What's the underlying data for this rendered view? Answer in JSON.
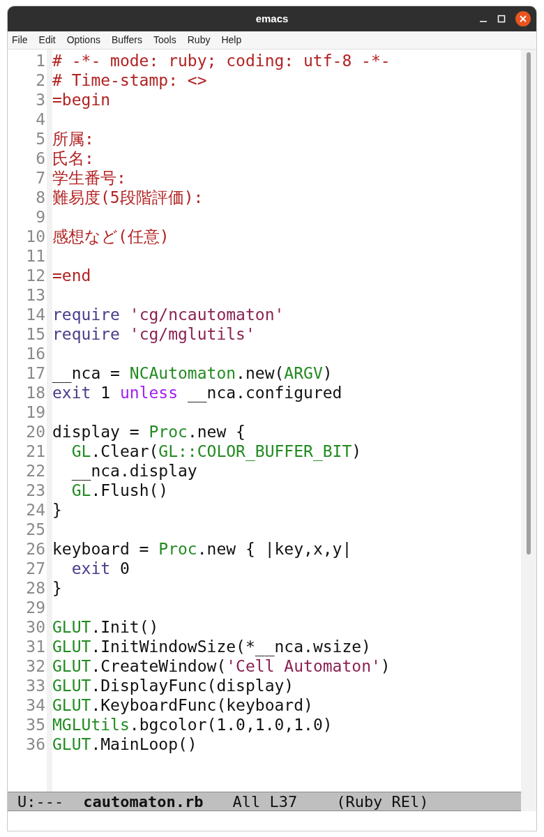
{
  "window": {
    "title": "emacs"
  },
  "menu": [
    "File",
    "Edit",
    "Options",
    "Buffers",
    "Tools",
    "Ruby",
    "Help"
  ],
  "lines": [
    {
      "number": "1",
      "tokens": [
        {
          "kind": "comment",
          "text": "# -*- mode: ruby; coding: utf-8 -*-"
        }
      ]
    },
    {
      "number": "2",
      "tokens": [
        {
          "kind": "comment",
          "text": "# Time-stamp: <>"
        }
      ]
    },
    {
      "number": "3",
      "tokens": [
        {
          "kind": "comment",
          "text": "=begin"
        }
      ]
    },
    {
      "number": "4"
    },
    {
      "number": "5",
      "tokens": [
        {
          "kind": "comment",
          "text": "所属:"
        }
      ]
    },
    {
      "number": "6",
      "tokens": [
        {
          "kind": "comment",
          "text": "氏名:"
        }
      ]
    },
    {
      "number": "7",
      "tokens": [
        {
          "kind": "comment",
          "text": "学生番号:"
        }
      ]
    },
    {
      "number": "8",
      "tokens": [
        {
          "kind": "comment",
          "text": "難易度(5段階評価):"
        }
      ]
    },
    {
      "number": "9"
    },
    {
      "number": "10",
      "tokens": [
        {
          "kind": "comment",
          "text": "感想など(任意)"
        }
      ]
    },
    {
      "number": "11"
    },
    {
      "number": "12",
      "tokens": [
        {
          "kind": "comment",
          "text": "=end"
        }
      ]
    },
    {
      "number": "13"
    },
    {
      "number": "14",
      "tokens": [
        {
          "kind": "keyword",
          "text": "require "
        },
        {
          "kind": "string",
          "text": "'cg/ncautomaton'"
        }
      ]
    },
    {
      "number": "15",
      "tokens": [
        {
          "kind": "keyword",
          "text": "require "
        },
        {
          "kind": "string",
          "text": "'cg/mglutils'"
        }
      ]
    },
    {
      "number": "16"
    },
    {
      "number": "17",
      "tokens": [
        {
          "kind": "plain",
          "text": "__nca = "
        },
        {
          "kind": "constant",
          "text": "NCAutomaton"
        },
        {
          "kind": "plain",
          "text": ".new("
        },
        {
          "kind": "constant",
          "text": "ARGV"
        },
        {
          "kind": "plain",
          "text": ")"
        }
      ]
    },
    {
      "number": "18",
      "tokens": [
        {
          "kind": "keyword",
          "text": "exit"
        },
        {
          "kind": "plain",
          "text": " 1 "
        },
        {
          "kind": "builtin",
          "text": "unless"
        },
        {
          "kind": "plain",
          "text": " __nca.configured"
        }
      ]
    },
    {
      "number": "19"
    },
    {
      "number": "20",
      "tokens": [
        {
          "kind": "plain",
          "text": "display = "
        },
        {
          "kind": "constant",
          "text": "Proc"
        },
        {
          "kind": "plain",
          "text": ".new {"
        }
      ]
    },
    {
      "number": "21",
      "tokens": [
        {
          "kind": "constant",
          "text": "  GL"
        },
        {
          "kind": "plain",
          "text": ".Clear("
        },
        {
          "kind": "constant",
          "text": "GL::COLOR_BUFFER_BIT"
        },
        {
          "kind": "plain",
          "text": ")"
        }
      ]
    },
    {
      "number": "22",
      "tokens": [
        {
          "kind": "plain",
          "text": "  __nca.display"
        }
      ]
    },
    {
      "number": "23",
      "tokens": [
        {
          "kind": "constant",
          "text": "  GL"
        },
        {
          "kind": "plain",
          "text": ".Flush()"
        }
      ]
    },
    {
      "number": "24",
      "tokens": [
        {
          "kind": "plain",
          "text": "}"
        }
      ]
    },
    {
      "number": "25"
    },
    {
      "number": "26",
      "tokens": [
        {
          "kind": "plain",
          "text": "keyboard = "
        },
        {
          "kind": "constant",
          "text": "Proc"
        },
        {
          "kind": "plain",
          "text": ".new { |key,x,y|"
        }
      ]
    },
    {
      "number": "27",
      "tokens": [
        {
          "kind": "keyword",
          "text": "  exit"
        },
        {
          "kind": "plain",
          "text": " 0"
        }
      ]
    },
    {
      "number": "28",
      "tokens": [
        {
          "kind": "plain",
          "text": "}"
        }
      ]
    },
    {
      "number": "29"
    },
    {
      "number": "30",
      "tokens": [
        {
          "kind": "constant",
          "text": "GLUT"
        },
        {
          "kind": "plain",
          "text": ".Init()"
        }
      ]
    },
    {
      "number": "31",
      "tokens": [
        {
          "kind": "constant",
          "text": "GLUT"
        },
        {
          "kind": "plain",
          "text": ".InitWindowSize(*__nca.wsize)"
        }
      ]
    },
    {
      "number": "32",
      "tokens": [
        {
          "kind": "constant",
          "text": "GLUT"
        },
        {
          "kind": "plain",
          "text": ".CreateWindow("
        },
        {
          "kind": "string",
          "text": "'Cell Automaton'"
        },
        {
          "kind": "plain",
          "text": ")"
        }
      ]
    },
    {
      "number": "33",
      "tokens": [
        {
          "kind": "constant",
          "text": "GLUT"
        },
        {
          "kind": "plain",
          "text": ".DisplayFunc(display)"
        }
      ]
    },
    {
      "number": "34",
      "tokens": [
        {
          "kind": "constant",
          "text": "GLUT"
        },
        {
          "kind": "plain",
          "text": ".KeyboardFunc(keyboard)"
        }
      ]
    },
    {
      "number": "35",
      "tokens": [
        {
          "kind": "constant",
          "text": "MGLUtils"
        },
        {
          "kind": "plain",
          "text": ".bgcolor(1.0,1.0,1.0)"
        }
      ]
    },
    {
      "number": "36",
      "tokens": [
        {
          "kind": "constant",
          "text": "GLUT"
        },
        {
          "kind": "plain",
          "text": ".MainLoop()"
        }
      ]
    }
  ],
  "mode_line": {
    "state": "U:---",
    "buffer": "cautomaton.rb",
    "position": "All L37",
    "mode": "(Ruby REl)"
  }
}
